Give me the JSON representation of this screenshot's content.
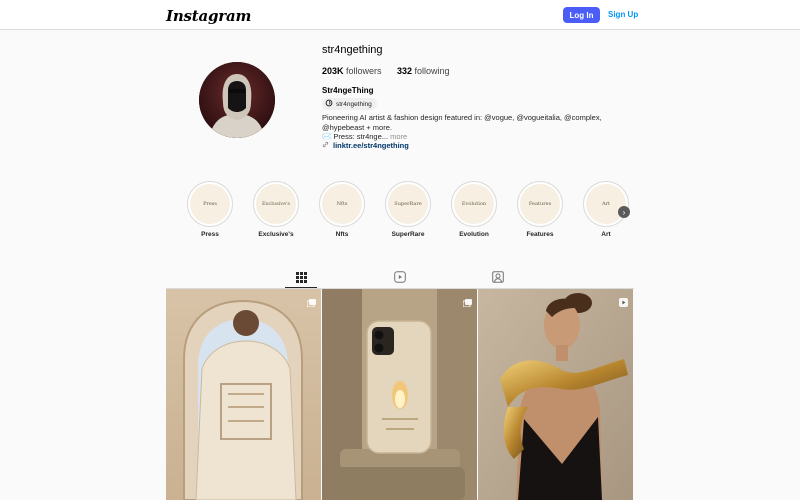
{
  "header": {
    "logo": "Instagram",
    "login_label": "Log In",
    "signup_label": "Sign Up"
  },
  "profile": {
    "username": "str4ngething",
    "followers_count": "203K",
    "followers_label": "followers",
    "following_count": "332",
    "following_label": "following",
    "full_name": "Str4ngeThing",
    "threads_handle": "str4ngething",
    "bio": "Pioneering AI artist & fashion design featured in: @vogue, @vogueitalia, @complex, @hypebeast + more.",
    "bio_line2": "✉️ Press: str4nge...",
    "more_label": "more",
    "link": "linktr.ee/str4ngething"
  },
  "highlights": [
    {
      "label": "Press",
      "cover_text": "Press"
    },
    {
      "label": "Exclusive's",
      "cover_text": "Exclusive's"
    },
    {
      "label": "Nfts",
      "cover_text": "Nfts"
    },
    {
      "label": "SuperRare",
      "cover_text": "SuperRare"
    },
    {
      "label": "Evolution",
      "cover_text": "Evolution"
    },
    {
      "label": "Features",
      "cover_text": "Features"
    },
    {
      "label": "Art",
      "cover_text": "Art"
    }
  ],
  "tabs": [
    {
      "icon": "grid-icon",
      "active": true
    },
    {
      "icon": "reels-icon",
      "active": false
    },
    {
      "icon": "tagged-icon",
      "active": false
    }
  ],
  "posts": [
    {
      "subject": "ornate-jacket-back",
      "badge": "carousel-icon"
    },
    {
      "subject": "sculpted-phone-case",
      "badge": "carousel-icon"
    },
    {
      "subject": "gold-shoulder-dress",
      "badge": "reel-icon"
    }
  ],
  "colors": {
    "accent": "#4a5ef7",
    "link": "#0095f6",
    "bio_link": "#00376b"
  }
}
